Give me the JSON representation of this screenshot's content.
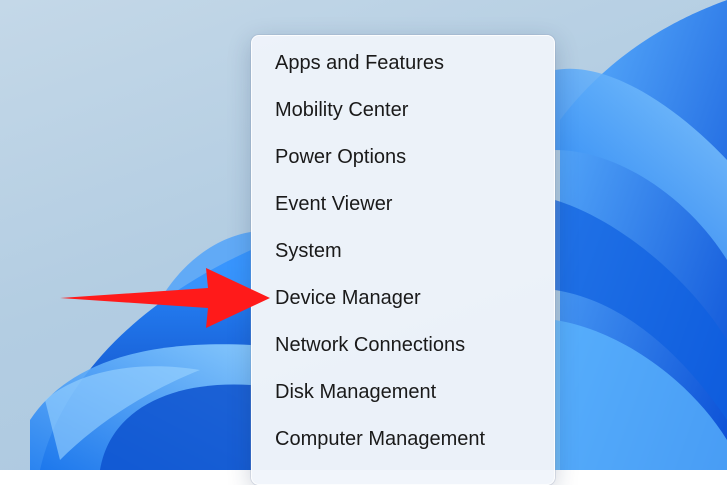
{
  "context_menu": {
    "items": [
      {
        "label": "Apps and Features"
      },
      {
        "label": "Mobility Center"
      },
      {
        "label": "Power Options"
      },
      {
        "label": "Event Viewer"
      },
      {
        "label": "System"
      },
      {
        "label": "Device Manager"
      },
      {
        "label": "Network Connections"
      },
      {
        "label": "Disk Management"
      },
      {
        "label": "Computer Management"
      }
    ]
  },
  "annotation": {
    "arrow_color": "#ff1a1a",
    "points_to": "Device Manager"
  },
  "colors": {
    "desktop_bg": "#b3cde2",
    "bloom_blue": "#1a73e8",
    "menu_bg": "#f0f4fb",
    "text": "#1a1a1a"
  }
}
